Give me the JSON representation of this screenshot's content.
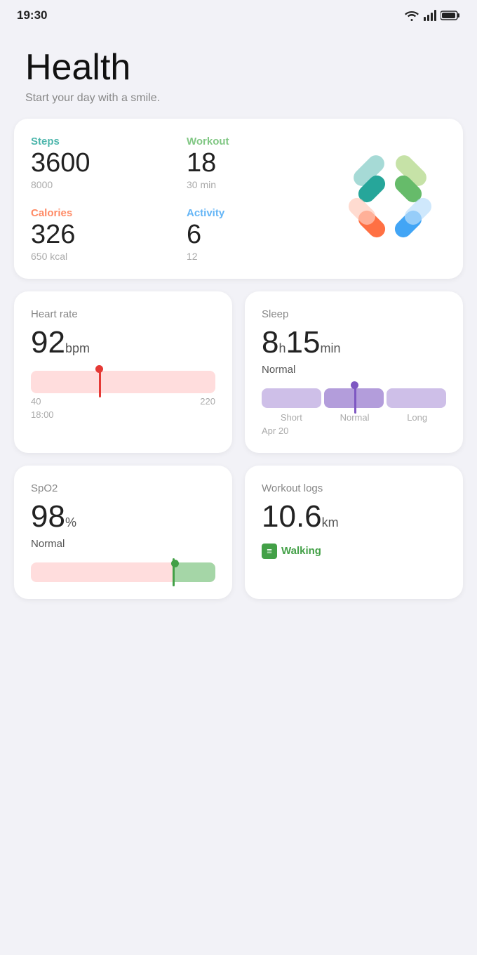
{
  "statusBar": {
    "time": "19:30"
  },
  "header": {
    "title": "Health",
    "subtitle": "Start your day with a smile."
  },
  "summary": {
    "steps": {
      "label": "Steps",
      "value": "3600",
      "target": "8000"
    },
    "workout": {
      "label": "Workout",
      "value": "18",
      "target": "30 min"
    },
    "calories": {
      "label": "Calories",
      "value": "326",
      "target": "650 kcal"
    },
    "activity": {
      "label": "Activity",
      "value": "6",
      "target": "12"
    }
  },
  "heartRate": {
    "label": "Heart rate",
    "value": "92",
    "unit": "bpm",
    "rangeMin": "40",
    "rangeMax": "220",
    "time": "18:00"
  },
  "sleep": {
    "label": "Sleep",
    "hours": "8",
    "minutes": "15",
    "status": "Normal",
    "rangeLabels": [
      "Short",
      "Normal",
      "Long"
    ],
    "date": "Apr 20"
  },
  "spo2": {
    "label": "SpO2",
    "value": "98",
    "unit": "%",
    "status": "Normal"
  },
  "workoutLogs": {
    "label": "Workout logs",
    "value": "10.6",
    "unit": "km",
    "activity": "Walking"
  }
}
